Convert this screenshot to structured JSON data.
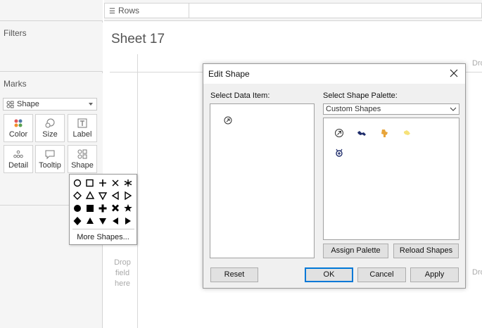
{
  "rows_shelf": {
    "label": "Rows"
  },
  "filters": {
    "title": "Filters"
  },
  "marks": {
    "title": "Marks",
    "mark_type": "Shape",
    "buttons": [
      {
        "label": "Color",
        "icon": "color-dots-icon"
      },
      {
        "label": "Size",
        "icon": "size-icon"
      },
      {
        "label": "Label",
        "icon": "label-t-icon"
      },
      {
        "label": "Detail",
        "icon": "detail-dots-icon"
      },
      {
        "label": "Tooltip",
        "icon": "tooltip-bubble-icon"
      },
      {
        "label": "Shape",
        "icon": "shape-icon"
      }
    ]
  },
  "sheet": {
    "title": "Sheet 17",
    "drop_field": "Drop field here",
    "drop_right_top": "Dro",
    "drop_right_bottom": "Dro"
  },
  "shape_popup": {
    "more_label": "More Shapes..."
  },
  "edit_shape_dialog": {
    "title": "Edit Shape",
    "select_data_item_label": "Select Data Item:",
    "select_palette_label": "Select Shape Palette:",
    "palette_selected": "Custom Shapes",
    "assign_palette": "Assign Palette",
    "reload_shapes": "Reload Shapes",
    "reset": "Reset",
    "ok": "OK",
    "cancel": "Cancel",
    "apply": "Apply"
  },
  "colors": {
    "accent_blue": "#0078d7",
    "navy_shape": "#1f2d6b",
    "gold_shape": "#e8a53a",
    "light_yellow_shape": "#f6e27a",
    "color_red": "#e15759",
    "color_blue": "#4e79a7"
  }
}
